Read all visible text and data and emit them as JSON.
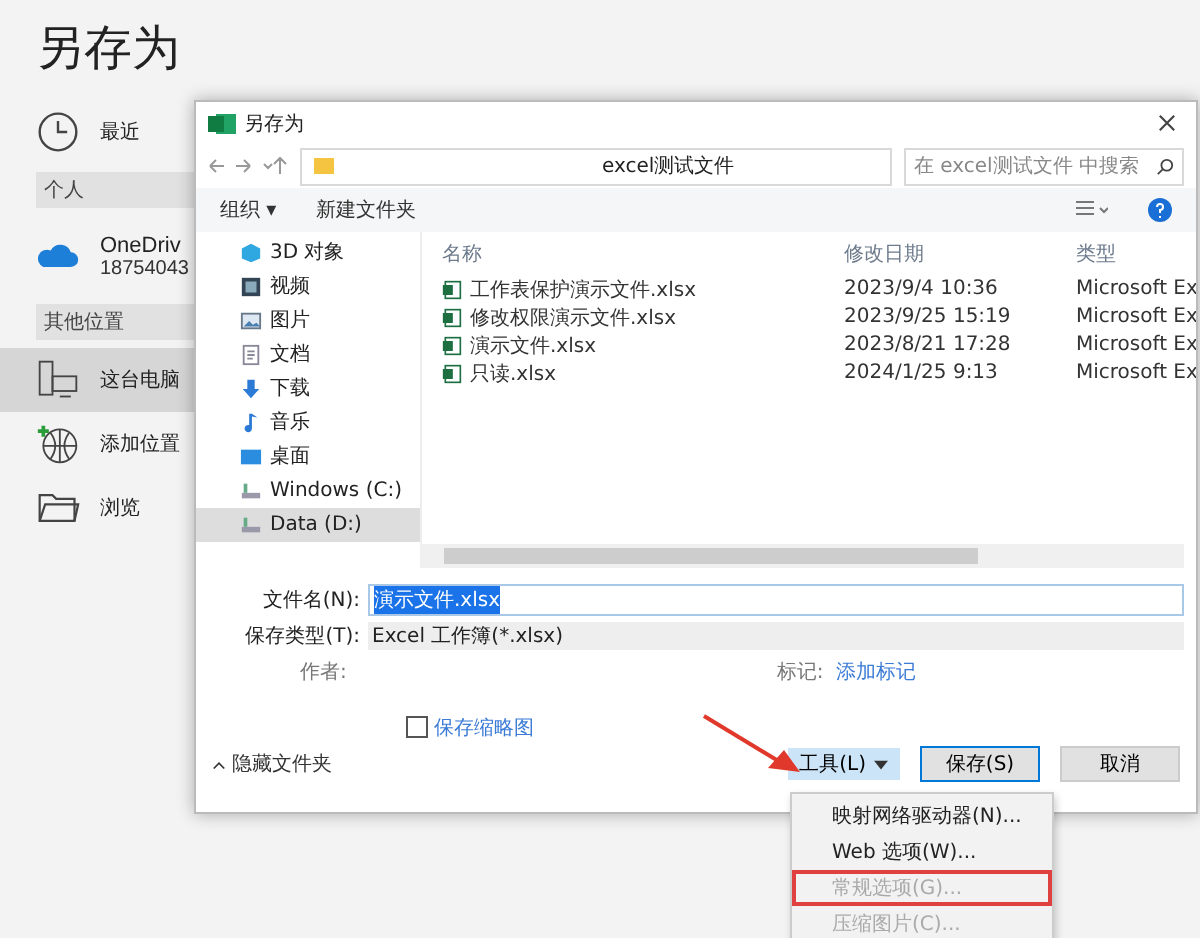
{
  "page_title": "另存为",
  "locations": [
    {
      "kind": "item",
      "label": "最近",
      "selected": false
    },
    {
      "kind": "header",
      "label": "个人"
    },
    {
      "kind": "account",
      "label": "OneDriv",
      "sub": "18754043"
    },
    {
      "kind": "header",
      "label": "其他位置"
    },
    {
      "kind": "item",
      "label": "这台电脑",
      "selected": true
    },
    {
      "kind": "item",
      "label": "添加位置",
      "selected": false
    },
    {
      "kind": "item",
      "label": "浏览",
      "selected": false
    }
  ],
  "dialog": {
    "title": "另存为",
    "address": "excel测试文件",
    "search": {
      "placeholder": "在 excel测试文件 中搜索"
    },
    "toolbar": [
      "组织 ▾",
      "新建文件夹"
    ],
    "nav": [
      {
        "label": "3D 对象",
        "selected": false
      },
      {
        "label": "视频",
        "selected": false
      },
      {
        "label": "图片",
        "selected": false
      },
      {
        "label": "文档",
        "selected": false
      },
      {
        "label": "下载",
        "selected": false
      },
      {
        "label": "音乐",
        "selected": false
      },
      {
        "label": "桌面",
        "selected": false
      },
      {
        "label": "Windows (C:)",
        "selected": false
      },
      {
        "label": "Data (D:)",
        "selected": true
      }
    ],
    "columns": [
      "名称",
      "修改日期",
      "类型"
    ],
    "files": [
      {
        "name": "工作表保护演示文件.xlsx",
        "date": "2023/9/4 10:36",
        "type": "Microsoft Ex"
      },
      {
        "name": "修改权限演示文件.xlsx",
        "date": "2023/9/25 15:19",
        "type": "Microsoft Ex"
      },
      {
        "name": "演示文件.xlsx",
        "date": "2023/8/21 17:28",
        "type": "Microsoft Ex"
      },
      {
        "name": "只读.xlsx",
        "date": "2024/1/25 9:13",
        "type": "Microsoft Ex"
      }
    ],
    "filename_label": "文件名(N):",
    "filename": "演示文件.xlsx",
    "filetype_label": "保存类型(T):",
    "filetype": "Excel 工作簿(*.xlsx)",
    "author_label": "作者:",
    "tags_label": "标记:",
    "tags_link": "添加标记",
    "thumbnail": {
      "label": "保存缩略图",
      "checked": false
    },
    "hide_folders": "隐藏文件夹",
    "tools": "工具(L)",
    "save": "保存(S)",
    "cancel": "取消"
  },
  "tools_menu": [
    {
      "label": "映射网络驱动器(N)...",
      "disabled": false,
      "boxed": false
    },
    {
      "label": "Web 选项(W)...",
      "disabled": false,
      "boxed": false
    },
    {
      "label": "常规选项(G)...",
      "disabled": true,
      "boxed": true
    },
    {
      "label": "压缩图片(C)...",
      "disabled": true,
      "boxed": false
    }
  ]
}
